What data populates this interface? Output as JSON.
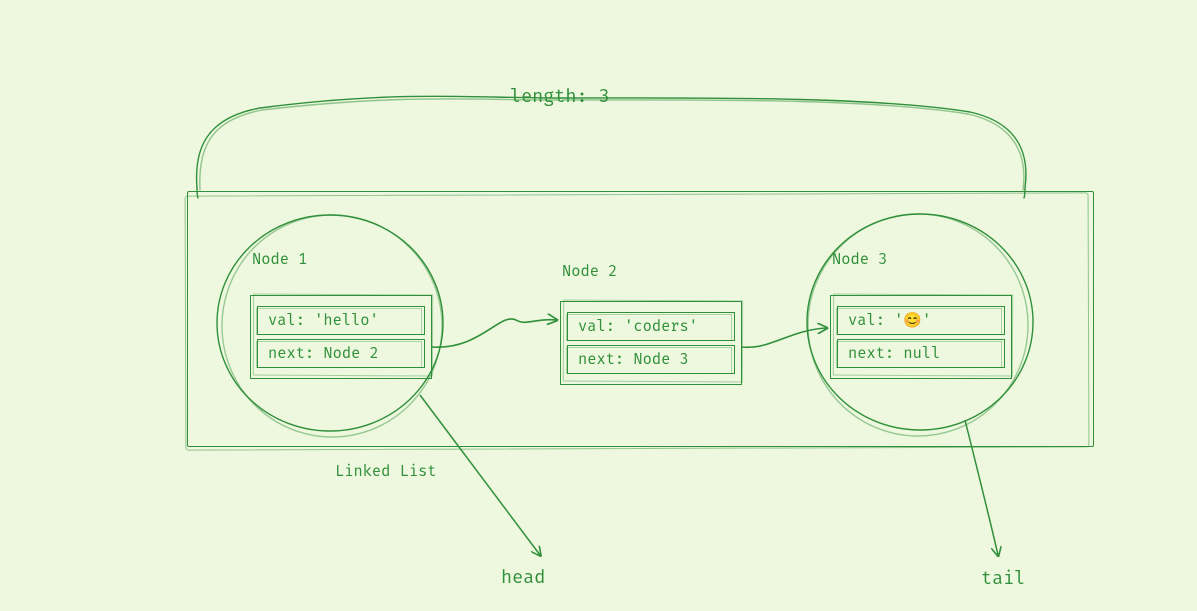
{
  "length_label": "length: 3",
  "container_label": "Linked List",
  "head_label": "head",
  "tail_label": "tail",
  "nodes": [
    {
      "title": "Node 1",
      "val": "val: 'hello'",
      "next": "next: Node 2"
    },
    {
      "title": "Node 2",
      "val": "val: 'coders'",
      "next": "next: Node 3"
    },
    {
      "title": "Node 3",
      "val": "val: '😊'",
      "next": "next: null"
    }
  ],
  "chart_data": {
    "type": "diagram",
    "structure": "singly-linked-list",
    "length": 3,
    "head": "Node 1",
    "tail": "Node 3",
    "nodes": [
      {
        "id": "Node 1",
        "val": "hello",
        "next": "Node 2"
      },
      {
        "id": "Node 2",
        "val": "coders",
        "next": "Node 3"
      },
      {
        "id": "Node 3",
        "val": "😊",
        "next": null
      }
    ]
  }
}
